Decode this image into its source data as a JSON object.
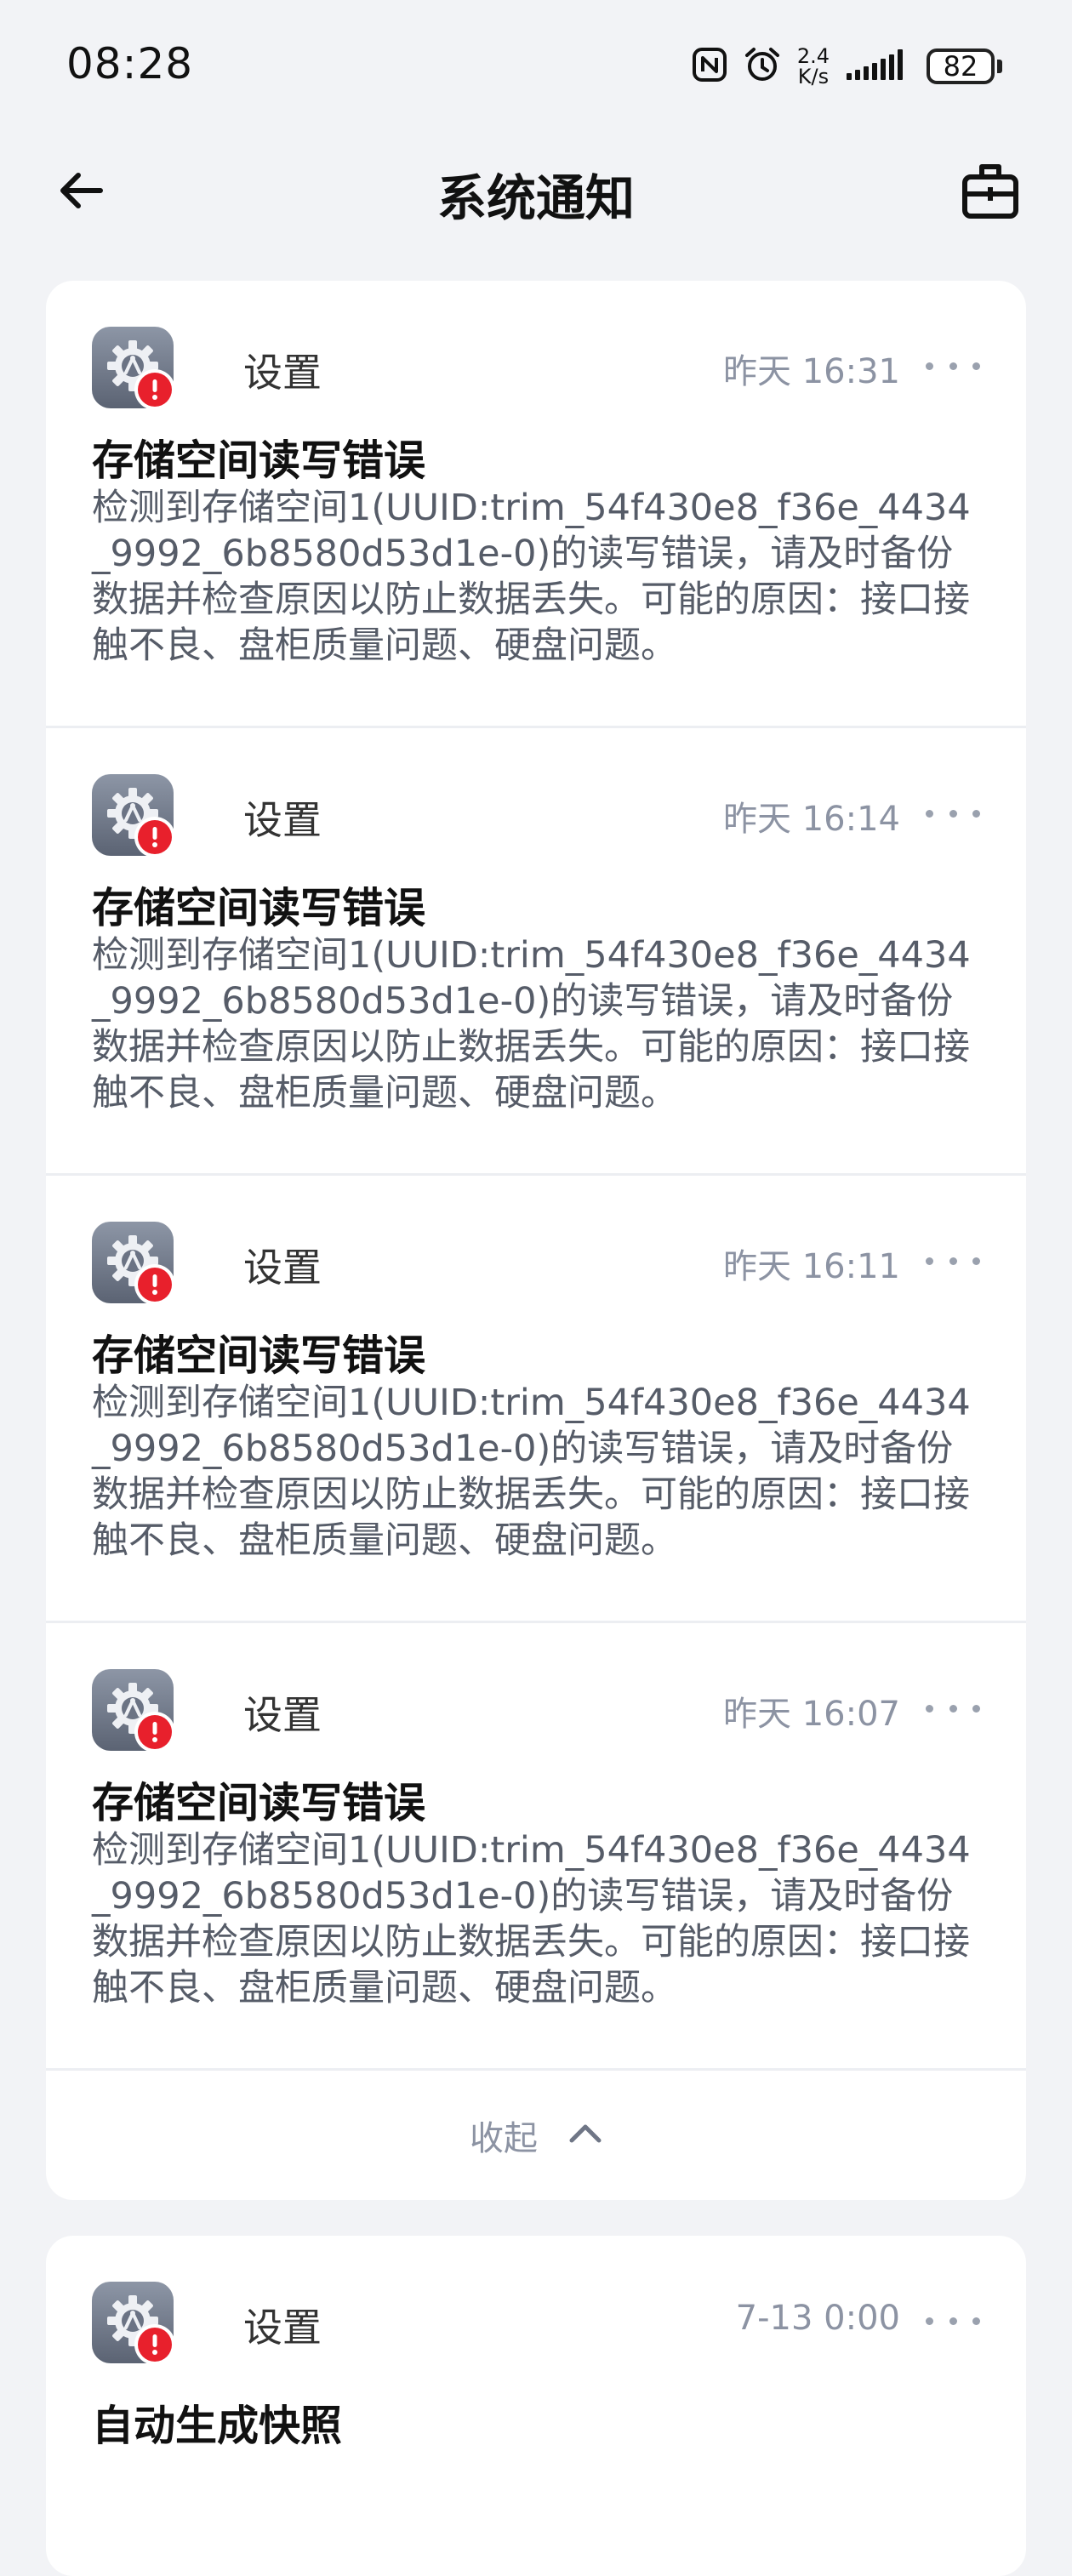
{
  "status_bar": {
    "time": "08:28",
    "speed_value": "2.4",
    "speed_unit": "K/s",
    "battery": "82"
  },
  "header": {
    "title": "系统通知"
  },
  "notifications": [
    {
      "app": "设置",
      "time": "昨天 16:31",
      "title": "存储空间读写错误",
      "body": "检测到存储空间1(UUID:trim_54f430e8_f36e_4434_9992_6b8580d53d1e-0)的读写错误，请及时备份数据并检查原因以防止数据丢失。可能的原因：接口接触不良、盘柜质量问题、硬盘问题。"
    },
    {
      "app": "设置",
      "time": "昨天 16:14",
      "title": "存储空间读写错误",
      "body": "检测到存储空间1(UUID:trim_54f430e8_f36e_4434_9992_6b8580d53d1e-0)的读写错误，请及时备份数据并检查原因以防止数据丢失。可能的原因：接口接触不良、盘柜质量问题、硬盘问题。"
    },
    {
      "app": "设置",
      "time": "昨天 16:11",
      "title": "存储空间读写错误",
      "body": "检测到存储空间1(UUID:trim_54f430e8_f36e_4434_9992_6b8580d53d1e-0)的读写错误，请及时备份数据并检查原因以防止数据丢失。可能的原因：接口接触不良、盘柜质量问题、硬盘问题。"
    },
    {
      "app": "设置",
      "time": "昨天 16:07",
      "title": "存储空间读写错误",
      "body": "检测到存储空间1(UUID:trim_54f430e8_f36e_4434_9992_6b8580d53d1e-0)的读写错误，请及时备份数据并检查原因以防止数据丢失。可能的原因：接口接触不良、盘柜质量问题、硬盘问题。"
    }
  ],
  "collapse_label": "收起",
  "next_notification": {
    "app": "设置",
    "time": "7-13 0:00",
    "title": "自动生成快照"
  },
  "icons": {
    "back": "arrow-left-icon",
    "clear": "clear-all-icon",
    "app": "settings-gear-icon",
    "alert": "alert-badge-icon",
    "more": "more-dots-icon",
    "collapse": "chevron-up-icon",
    "nfc": "nfc-icon",
    "alarm": "alarm-icon",
    "signal": "signal-icon"
  },
  "colors": {
    "background": "#f2f3f6",
    "card": "#ffffff",
    "alert_red": "#e8202c",
    "secondary_text": "#8c93a3"
  }
}
